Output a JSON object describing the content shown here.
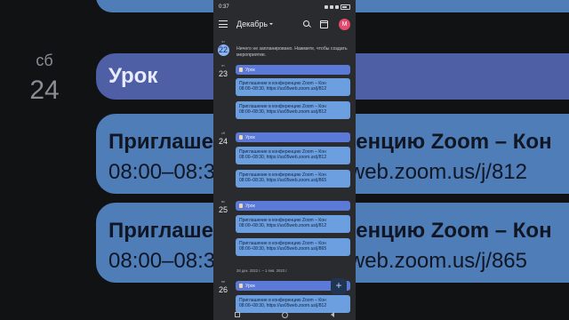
{
  "status": {
    "time": "0:37"
  },
  "header": {
    "month": "Декабрь",
    "avatar_letter": "M"
  },
  "today": {
    "dow": "чт",
    "num": "22",
    "empty_text": "Ничего не запланировано. Нажмите, чтобы создать мероприятие."
  },
  "days": [
    {
      "dow": "пт",
      "num": "23"
    },
    {
      "dow": "сб",
      "num": "24"
    },
    {
      "dow": "вс",
      "num": "25"
    },
    {
      "dow": "пн",
      "num": "26"
    }
  ],
  "events": {
    "lesson_title": "Урок",
    "zoom_title": "Приглашение в конференцию Zoom – Кон",
    "zoom_time_812": "08:00–08:30, https://us05web.zoom.us/j/812",
    "zoom_time_865": "08:00–08:30, https://us05web.zoom.us/j/865"
  },
  "week_range": "26 дек. 2022 г. – 1 янв. 2023 г.",
  "fab_label": "+",
  "background": {
    "dow": "сб",
    "num": "24",
    "lesson_title": "Урок",
    "zoom_title": "Приглашение в конференцию Zoom – Кон",
    "zoom_time_812": "08:00–08:30, https://us05web.zoom.us/j/812",
    "zoom_time_865": "08:00–08:30, https://us05web.zoom.us/j/865"
  }
}
